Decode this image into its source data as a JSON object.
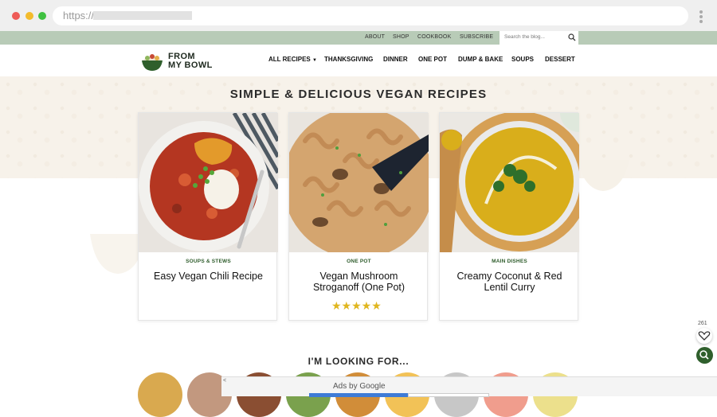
{
  "browser": {
    "url_prefix": "https://"
  },
  "topbar": {
    "links": [
      "ABOUT",
      "SHOP",
      "COOKBOOK",
      "SUBSCRIBE"
    ],
    "search_placeholder": "Search the blog..."
  },
  "header": {
    "logo_line1": "FROM",
    "logo_line2": "MY BOWL",
    "nav": [
      "ALL RECIPES",
      "THANKSGIVING",
      "DINNER",
      "ONE POT",
      "DUMP & BAKE",
      "SOUPS",
      "DESSERT"
    ]
  },
  "hero": {
    "title": "SIMPLE & DELICIOUS VEGAN RECIPES"
  },
  "cards": [
    {
      "category": "SOUPS & STEWS",
      "title": "Easy Vegan Chili Recipe"
    },
    {
      "category": "ONE POT",
      "title": "Vegan Mushroom Stroganoff (One Pot)",
      "rating_stars": "★★★★★"
    },
    {
      "category": "MAIN DISHES",
      "title": "Creamy Coconut & Red Lentil Curry"
    }
  ],
  "looking_for": {
    "title": "I'M LOOKING FOR..."
  },
  "ad": {
    "label": "Ads by Google",
    "close_symbol": "<"
  },
  "floating": {
    "favorites_count": "261"
  },
  "colors": {
    "topbar": "#b8cbb7",
    "brand_green": "#2d5b2a",
    "star": "#e0b61f"
  }
}
